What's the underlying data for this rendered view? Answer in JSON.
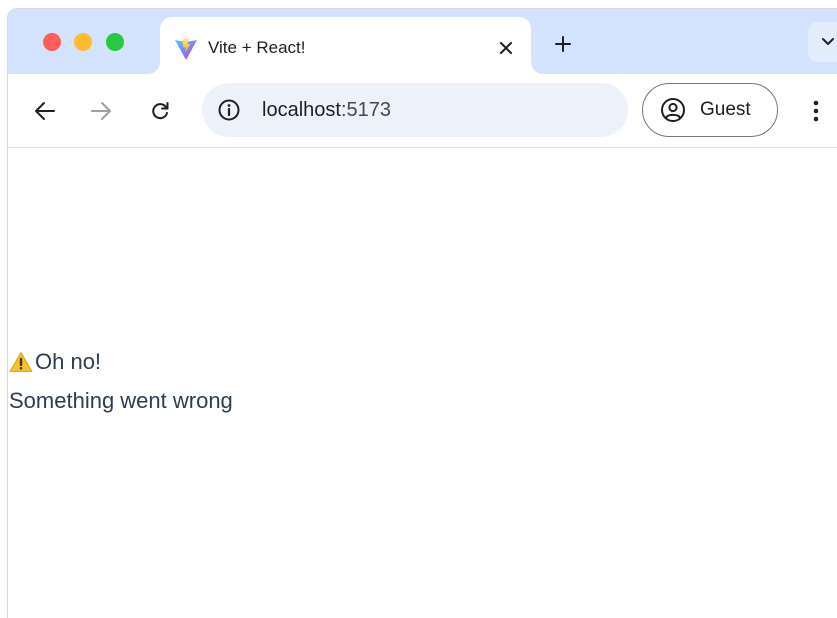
{
  "browser": {
    "tab": {
      "title": "Vite + React!",
      "favicon": "vite-icon"
    },
    "address_bar": {
      "host": "localhost",
      "port": ":5173"
    },
    "profile": {
      "label": "Guest"
    }
  },
  "page": {
    "error_title": "Oh no!",
    "error_message": "Something went wrong",
    "warning_icon": "warning-icon"
  },
  "colors": {
    "tabstrip": "#d3e3fd",
    "omnibox": "#edf2fa",
    "text": "#2c3e50",
    "warning": "#f6c12c"
  }
}
